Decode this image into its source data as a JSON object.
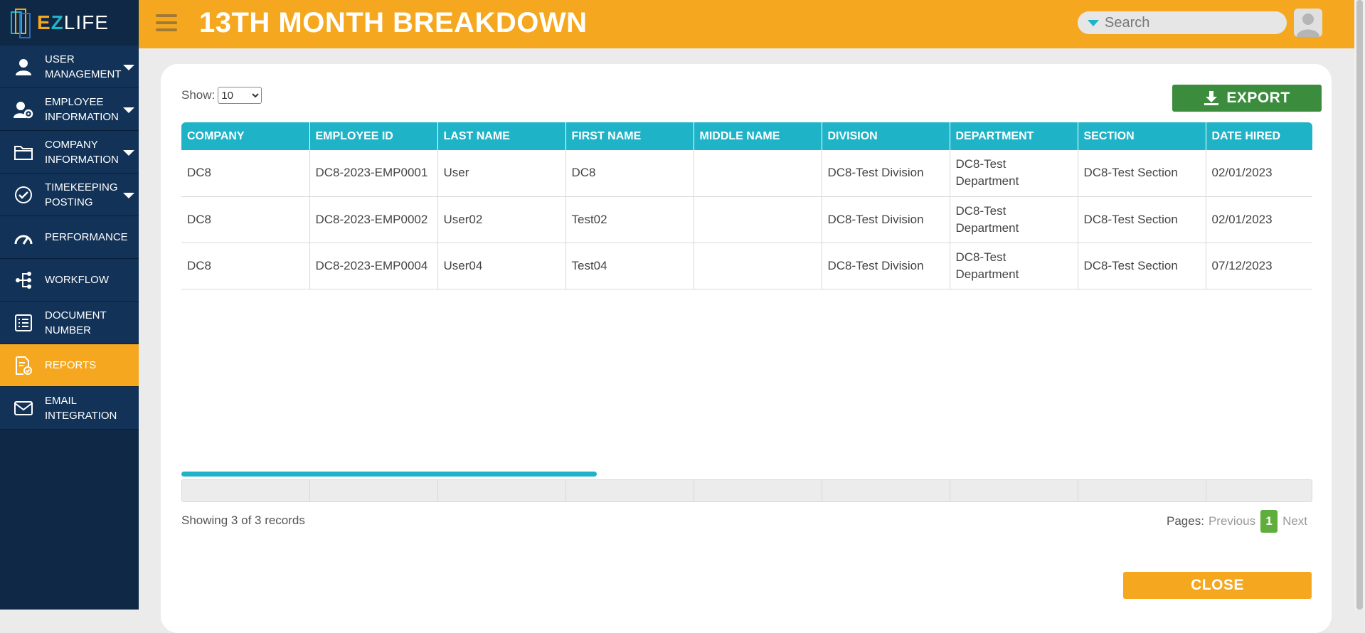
{
  "app": {
    "logo_text_e": "E",
    "logo_text_z": "Z",
    "logo_text_life": "LIFE"
  },
  "header": {
    "title": "13TH MONTH BREAKDOWN",
    "search_placeholder": "Search"
  },
  "sidebar": {
    "items": [
      {
        "label": "USER MANAGEMENT",
        "icon": "user-icon",
        "has_caret": true
      },
      {
        "label": "EMPLOYEE INFORMATION",
        "icon": "employee-settings-icon",
        "has_caret": true
      },
      {
        "label": "COMPANY INFORMATION",
        "icon": "folder-icon",
        "has_caret": true
      },
      {
        "label": "TIMEKEEPING POSTING",
        "icon": "check-circle-icon",
        "has_caret": true
      },
      {
        "label": "PERFORMANCE",
        "icon": "gauge-icon",
        "has_caret": false
      },
      {
        "label": "WORKFLOW",
        "icon": "workflow-icon",
        "has_caret": false
      },
      {
        "label": "DOCUMENT NUMBER",
        "icon": "document-list-icon",
        "has_caret": false
      },
      {
        "label": "REPORTS",
        "icon": "report-icon",
        "has_caret": false,
        "active": true
      },
      {
        "label": "EMAIL INTEGRATION",
        "icon": "mail-icon",
        "has_caret": false
      }
    ]
  },
  "controls": {
    "show_label": "Show:",
    "show_value": "10",
    "export_label": "EXPORT",
    "close_label": "CLOSE"
  },
  "table": {
    "columns": [
      "COMPANY",
      "EMPLOYEE ID",
      "LAST NAME",
      "FIRST NAME",
      "MIDDLE NAME",
      "DIVISION",
      "DEPARTMENT",
      "SECTION",
      "DATE HIRED"
    ],
    "rows": [
      [
        "DC8",
        "DC8-2023-EMP0001",
        "User",
        "DC8",
        "",
        "DC8-Test Division",
        "DC8-Test Department",
        "DC8-Test Section",
        "02/01/2023"
      ],
      [
        "DC8",
        "DC8-2023-EMP0002",
        "User02",
        "Test02",
        "",
        "DC8-Test Division",
        "DC8-Test Department",
        "DC8-Test Section",
        "02/01/2023"
      ],
      [
        "DC8",
        "DC8-2023-EMP0004",
        "User04",
        "Test04",
        "",
        "DC8-Test Division",
        "DC8-Test Department",
        "DC8-Test Section",
        "07/12/2023"
      ]
    ]
  },
  "pagination": {
    "showing_text": "Showing 3 of 3 records",
    "pages_label": "Pages:",
    "previous": "Previous",
    "current_page": "1",
    "next": "Next"
  },
  "colors": {
    "brand_orange": "#f5a81f",
    "brand_teal": "#1fb3c8",
    "sidebar_navy": "#0e2845",
    "export_green": "#3b8d3d",
    "page_green": "#5fae3c"
  }
}
